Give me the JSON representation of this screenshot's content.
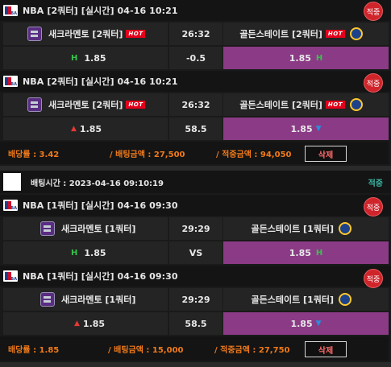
{
  "groups": [
    {
      "bets": [
        {
          "header": "NBA [2쿼터] [실시간] 04-16 10:21",
          "badge": "적중",
          "home": {
            "name": "새크라멘토 [2쿼터]",
            "hot": "HOT"
          },
          "score": "26:32",
          "away": {
            "name": "골든스테이트 [2쿼터]",
            "hot": "HOT"
          },
          "odds": {
            "left": "1.85",
            "left_mark": "H",
            "center": "-0.5",
            "right": "1.85",
            "right_mark": "H"
          }
        },
        {
          "header": "NBA [2쿼터] [실시간] 04-16 10:21",
          "badge": "적중",
          "home": {
            "name": "새크라멘토 [2쿼터]",
            "hot": "HOT"
          },
          "score": "26:32",
          "away": {
            "name": "골든스테이트 [2쿼터]",
            "hot": "HOT"
          },
          "odds": {
            "left": "1.85",
            "left_mark": "▲",
            "center": "58.5",
            "right": "1.85",
            "right_mark": "▼"
          }
        }
      ],
      "summary": {
        "rate": "배당률 : 3.42",
        "bet_amount": "/ 배팅금액 : 27,500",
        "win_amount": "/ 적중금액 : 94,050",
        "delete": "삭제"
      }
    },
    {
      "time_header": "배팅시간 : 2023-04-16 09:10:19",
      "time_badge": "적중",
      "bets": [
        {
          "header": "NBA [1쿼터] [실시간] 04-16 09:30",
          "badge": "적중",
          "home": {
            "name": "새크라멘토 [1쿼터]"
          },
          "score": "29:29",
          "away": {
            "name": "골든스테이트 [1쿼터]"
          },
          "odds": {
            "left": "1.85",
            "left_mark": "H",
            "center": "VS",
            "right": "1.85",
            "right_mark": "H"
          }
        },
        {
          "header": "NBA [1쿼터] [실시간] 04-16 09:30",
          "badge": "적중",
          "home": {
            "name": "새크라멘토 [1쿼터]"
          },
          "score": "29:29",
          "away": {
            "name": "골든스테이트 [1쿼터]"
          },
          "odds": {
            "left": "1.85",
            "left_mark": "▲",
            "center": "58.5",
            "right": "1.85",
            "right_mark": "▼"
          }
        }
      ],
      "summary": {
        "rate": "배당률 : 1.85",
        "bet_amount": "/ 배팅금액 : 15,000",
        "win_amount": "/ 적중금액 : 27,750",
        "delete": "삭제"
      }
    }
  ],
  "colors": {
    "selected": "#8b3b86",
    "badge": "#d0242b",
    "summary_text": "#f07a1a",
    "green_mark": "#39c24b",
    "up_mark": "#e53935",
    "down_mark": "#2b8ddb"
  }
}
